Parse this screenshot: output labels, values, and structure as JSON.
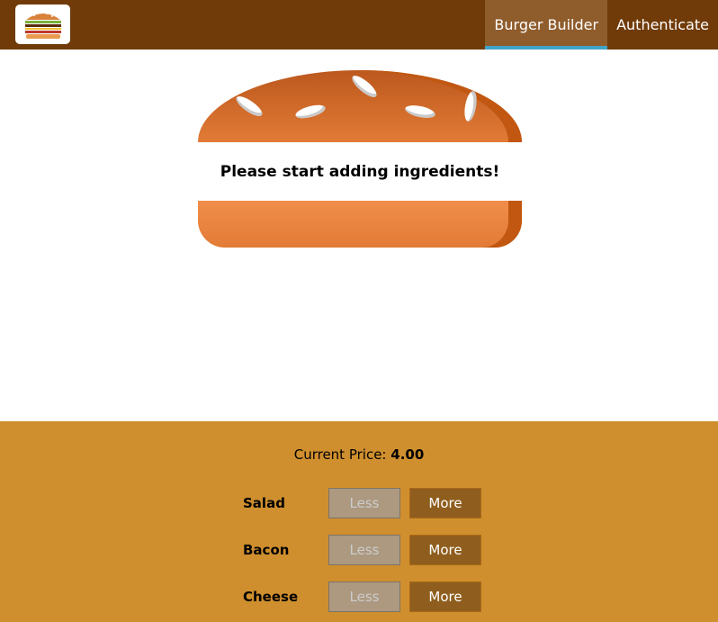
{
  "toolbar": {
    "logo_icon": "burger-logo-icon",
    "nav": [
      {
        "label": "Burger Builder",
        "active": true
      },
      {
        "label": "Authenticate",
        "active": false
      }
    ]
  },
  "burger": {
    "message": "Please start adding ingredients!"
  },
  "controls": {
    "price_label": "Current Price:",
    "price_value": "4.00",
    "items": [
      {
        "label": "Salad",
        "less": "Less",
        "more": "More"
      },
      {
        "label": "Bacon",
        "less": "Less",
        "more": "More"
      },
      {
        "label": "Cheese",
        "less": "Less",
        "more": "More"
      }
    ]
  },
  "colors": {
    "toolbar": "#703B09",
    "active_nav": "#8F5C2C",
    "active_indicator": "#40A4C8",
    "controls_bg": "#CF8F2E",
    "more_button": "#8F5E1E",
    "less_button_disabled": "#AC9980"
  }
}
